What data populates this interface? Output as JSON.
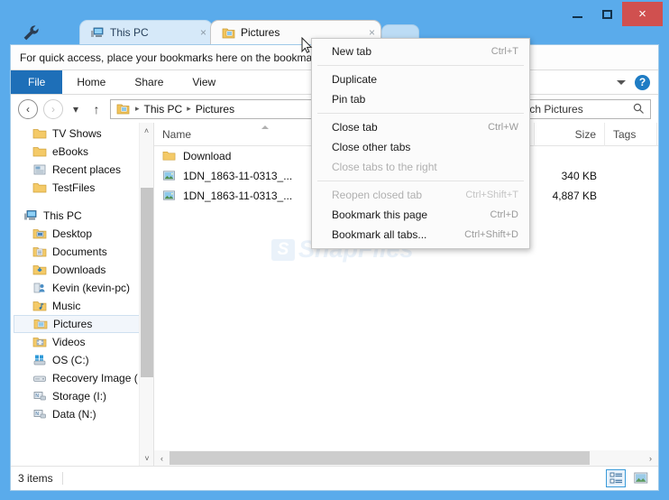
{
  "window": {
    "controls": {
      "minimize": "minimize-button",
      "maximize": "maximize-button",
      "close": "×"
    }
  },
  "tabs": [
    {
      "label": "This PC",
      "icon": "thispc-icon",
      "close": "×",
      "active": false
    },
    {
      "label": "Pictures",
      "icon": "folder-pictures-icon",
      "close": "×",
      "active": true
    }
  ],
  "bookmark_bar": {
    "text": "For quick access, place your bookmarks here on the bookmarks bar."
  },
  "ribbon": {
    "tabs": [
      "File",
      "Home",
      "Share",
      "View"
    ],
    "expand_icon": "chevron-down-icon",
    "help_icon": "?"
  },
  "address": {
    "back": "‹",
    "forward": "›",
    "recent": "▾",
    "up": "↑",
    "crumbs": [
      "This PC",
      "Pictures"
    ],
    "separator": "▸",
    "search_value": "Search Pictures",
    "search_placeholder": "Search Pictures"
  },
  "tree": {
    "items": [
      {
        "label": "TV Shows",
        "icon": "folder-icon",
        "level": 1,
        "selected": false
      },
      {
        "label": "eBooks",
        "icon": "folder-icon",
        "level": 1,
        "selected": false
      },
      {
        "label": "Recent places",
        "icon": "recent-places-icon",
        "level": 1,
        "selected": false
      },
      {
        "label": "TestFiles",
        "icon": "folder-icon",
        "level": 1,
        "selected": false
      },
      {
        "label": "",
        "icon": "spacer",
        "level": 0,
        "selected": false
      },
      {
        "label": "This PC",
        "icon": "thispc-icon",
        "level": 0,
        "selected": false
      },
      {
        "label": "Desktop",
        "icon": "folder-desktop-icon",
        "level": 1,
        "selected": false
      },
      {
        "label": "Documents",
        "icon": "folder-documents-icon",
        "level": 1,
        "selected": false
      },
      {
        "label": "Downloads",
        "icon": "folder-downloads-icon",
        "level": 1,
        "selected": false
      },
      {
        "label": "Kevin (kevin-pc)",
        "icon": "folder-user-icon",
        "level": 1,
        "selected": false
      },
      {
        "label": "Music",
        "icon": "folder-music-icon",
        "level": 1,
        "selected": false
      },
      {
        "label": "Pictures",
        "icon": "folder-pictures-icon",
        "level": 1,
        "selected": true
      },
      {
        "label": "Videos",
        "icon": "folder-videos-icon",
        "level": 1,
        "selected": false
      },
      {
        "label": "OS (C:)",
        "icon": "drive-os-icon",
        "level": 1,
        "selected": false
      },
      {
        "label": "Recovery Image (",
        "icon": "drive-icon",
        "level": 1,
        "selected": false
      },
      {
        "label": "Storage (I:)",
        "icon": "network-drive-icon",
        "level": 1,
        "selected": false
      },
      {
        "label": "Data (N:)",
        "icon": "network-drive-icon",
        "level": 1,
        "selected": false
      }
    ],
    "scroll_up": "˄",
    "scroll_down": "˅"
  },
  "filelist": {
    "columns": [
      "Name",
      "Size",
      "Tags"
    ],
    "rows": [
      {
        "name": "Download",
        "icon": "folder-icon",
        "size": "",
        "tags": ""
      },
      {
        "name": "1DN_1863-11-0313_...",
        "icon": "image-file-icon",
        "size": "340 KB",
        "tags": ""
      },
      {
        "name": "1DN_1863-11-0313_...",
        "icon": "image-file-icon",
        "size": "4,887 KB",
        "tags": ""
      }
    ],
    "watermark": "SnapFiles",
    "watermark_badge": "S",
    "hscroll_left": "‹",
    "hscroll_right": "›"
  },
  "status": {
    "item_count": "3 items",
    "view_details_icon": "details-view-icon",
    "view_thumbnails_icon": "thumbnail-view-icon"
  },
  "context_menu": {
    "items": [
      {
        "label": "New tab",
        "accel": "Ctrl+T",
        "disabled": false,
        "separator_after": true
      },
      {
        "label": "Duplicate",
        "accel": "",
        "disabled": false,
        "separator_after": false
      },
      {
        "label": "Pin tab",
        "accel": "",
        "disabled": false,
        "separator_after": true
      },
      {
        "label": "Close tab",
        "accel": "Ctrl+W",
        "disabled": false,
        "separator_after": false
      },
      {
        "label": "Close other tabs",
        "accel": "",
        "disabled": false,
        "separator_after": false
      },
      {
        "label": "Close tabs to the right",
        "accel": "",
        "disabled": true,
        "separator_after": true
      },
      {
        "label": "Reopen closed tab",
        "accel": "Ctrl+Shift+T",
        "disabled": true,
        "separator_after": false
      },
      {
        "label": "Bookmark this page",
        "accel": "Ctrl+D",
        "disabled": false,
        "separator_after": false
      },
      {
        "label": "Bookmark all tabs...",
        "accel": "Ctrl+Shift+D",
        "disabled": false,
        "separator_after": false
      }
    ]
  },
  "colors": {
    "titlebar": "#5aabeb",
    "close_button": "#d0504f",
    "file_tab": "#1e6fb8",
    "accent": "#1e7cc4"
  }
}
